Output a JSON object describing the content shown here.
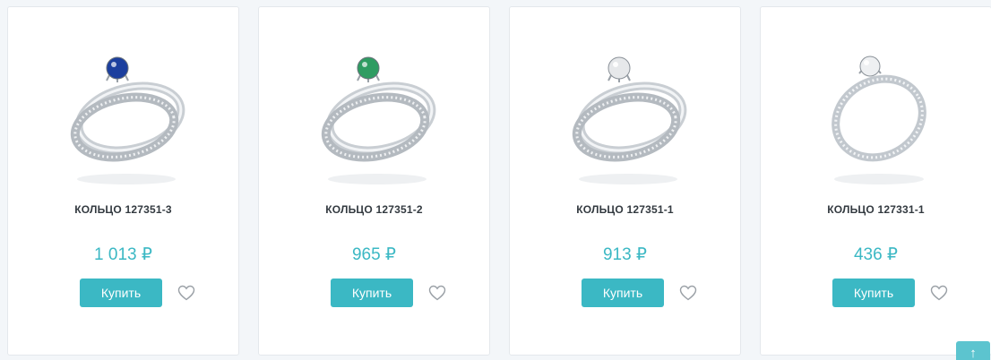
{
  "products": [
    {
      "title": "КОЛЬЦО 127351-3",
      "price": "1 013 ₽",
      "buy_label": "Купить",
      "stone_color": "#1c3f9e",
      "image": "ring-set"
    },
    {
      "title": "КОЛЬЦО 127351-2",
      "price": "965 ₽",
      "buy_label": "Купить",
      "stone_color": "#2f9c62",
      "image": "ring-set"
    },
    {
      "title": "КОЛЬЦО 127351-1",
      "price": "913 ₽",
      "buy_label": "Купить",
      "stone_color": "#e6e8ea",
      "image": "ring-set"
    },
    {
      "title": "КОЛЬЦО 127331-1",
      "price": "436 ₽",
      "buy_label": "Купить",
      "stone_color": "#eef0f2",
      "image": "single-ring"
    }
  ],
  "icons": {
    "favorite": "heart-outline-icon",
    "scroll_top": "arrow-up-icon"
  },
  "scroll_top": {
    "symbol": "↑"
  },
  "colors": {
    "accent": "#3bb8c4",
    "title": "#333a40",
    "background": "#f3f6f9"
  }
}
